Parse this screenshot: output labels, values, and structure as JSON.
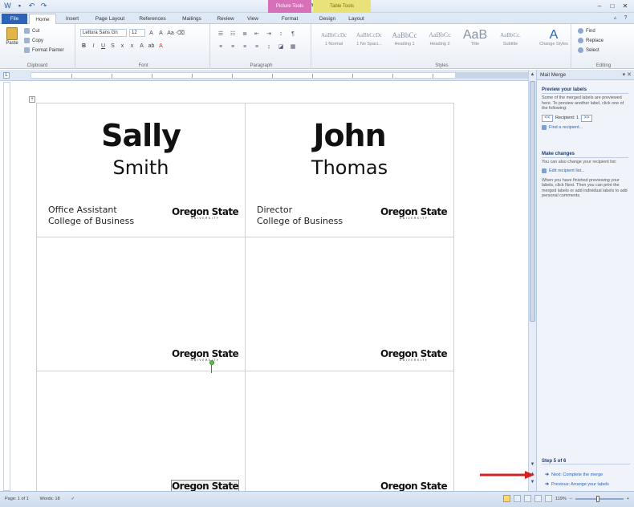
{
  "window": {
    "title": "Sample_nametags - Microsoft Word",
    "context_tabs": [
      "Picture Tools",
      "Table Tools"
    ]
  },
  "tabs": [
    "File",
    "Home",
    "Insert",
    "Page Layout",
    "References",
    "Mailings",
    "Review",
    "View",
    "Format",
    "Design",
    "Layout"
  ],
  "ribbon": {
    "clipboard": {
      "paste": "Paste",
      "cut": "Cut",
      "copy": "Copy",
      "format_painter": "Format Painter",
      "label": "Clipboard"
    },
    "font": {
      "font_name": "Lettura Sans Gn",
      "font_size": "12",
      "label": "Font"
    },
    "paragraph": {
      "label": "Paragraph"
    },
    "styles": {
      "items": [
        {
          "sample": "AaBbCcDc",
          "name": "1 Normal"
        },
        {
          "sample": "AaBbCcDc",
          "name": "1 No Spaci..."
        },
        {
          "sample": "AaBbCc",
          "name": "Heading 1"
        },
        {
          "sample": "AaBbCc",
          "name": "Heading 2"
        },
        {
          "sample": "AaB",
          "name": "Title"
        },
        {
          "sample": "AaBbCc.",
          "name": "Subtitle"
        }
      ],
      "change_styles": "Change Styles",
      "label": "Styles"
    },
    "editing": {
      "find": "Find",
      "replace": "Replace",
      "select": "Select",
      "label": "Editing"
    }
  },
  "labels": [
    {
      "first": "Sally",
      "last": "Smith",
      "title": "Office Assistant",
      "dept": "College of Business"
    },
    {
      "first": "John",
      "last": "Thomas",
      "title": "Director",
      "dept": "College of Business"
    }
  ],
  "logo": {
    "name": "Oregon State",
    "sub": "UNIVERSITY"
  },
  "mail_merge": {
    "pane_title": "Mail Merge",
    "preview_heading": "Preview your labels",
    "preview_text": "Some of the merged labels are previewed here. To preview another label, click one of the following:",
    "recipient": "Recipient: 1",
    "prev_btn": "<<",
    "next_btn": ">>",
    "find_recipient": "Find a recipient...",
    "changes_heading": "Make changes",
    "changes_text": "You can also change your recipient list:",
    "edit_list": "Edit recipient list...",
    "finish_text": "When you have finished previewing your labels, click Next. Then you can print the merged labels or add individual labels to add personal comments.",
    "step": "Step 5 of 6",
    "next_step": "Next: Complete the merge",
    "prev_step": "Previous: Arrange your labels"
  },
  "status": {
    "page": "Page: 1 of 1",
    "words": "Words: 18",
    "zoom": "119%"
  }
}
